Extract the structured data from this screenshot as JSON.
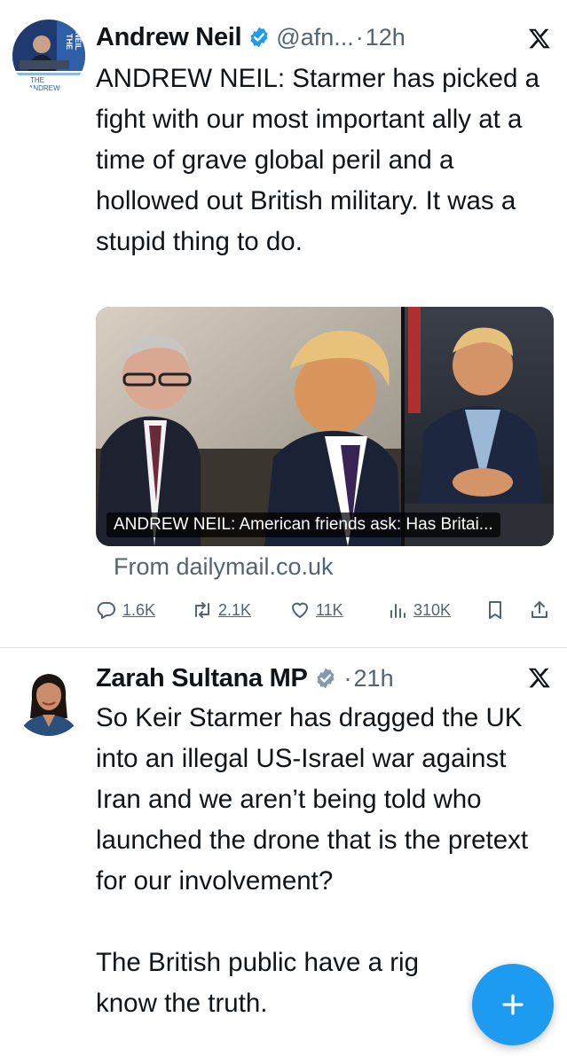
{
  "tweets": [
    {
      "name": "Andrew Neil",
      "handle": "@afn...",
      "sep": "·",
      "time": "12h",
      "text": "ANDREW NEIL: Starmer has picked a fight with our most important ally at a time of grave global peril and a hollowed out British military. It was a stupid thing to do.",
      "card": {
        "caption": "ANDREW NEIL: American friends ask: Has Britai...",
        "source": "From dailymail.co.uk"
      },
      "stats": {
        "replies": "1.6K",
        "reposts": "2.1K",
        "likes": "11K",
        "views": "310K"
      }
    },
    {
      "name": "Zarah Sultana MP",
      "sep": "·",
      "time": "21h",
      "text": "So Keir Starmer has dragged the UK into an illegal US-Israel war against Iran and we aren’t being told who launched the drone that is the pretext for our involvement?\n\nThe British public have a rig\nknow the truth."
    }
  ],
  "avatar_text": {
    "line1": "THE",
    "line2": "NEIL",
    "line3": "THE",
    "line4": "ANDREW"
  },
  "icons": {
    "verified": "verified-badge-icon",
    "verified_grey": "grey-verified-badge-icon",
    "x_logo": "x-logo-icon",
    "reply": "reply-icon",
    "repost": "repost-icon",
    "like": "heart-icon",
    "views": "views-icon",
    "bookmark": "bookmark-icon",
    "share": "share-icon",
    "compose": "plus-icon"
  },
  "colors": {
    "accent": "#1d9bf0",
    "text": "#0f1419",
    "secondary": "#536471",
    "verified_grey": "#829aab"
  }
}
